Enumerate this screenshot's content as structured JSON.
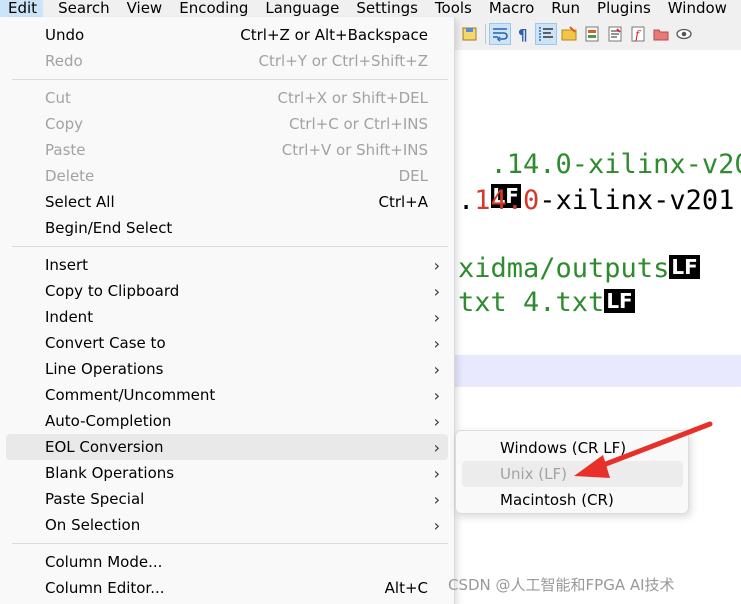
{
  "menubar": {
    "items": [
      "Edit",
      "Search",
      "View",
      "Encoding",
      "Language",
      "Settings",
      "Tools",
      "Macro",
      "Run",
      "Plugins",
      "Window"
    ]
  },
  "toolbar": {
    "icons": [
      "save-all-icon",
      "word-wrap-icon",
      "show-all-characters-icon",
      "indent-guide-icon",
      "folder-workspace-icon",
      "document-map-icon",
      "function-list-icon",
      "folder-icon",
      "monitoring-icon"
    ]
  },
  "editor": {
    "lines": [
      {
        "text": ".14.0-xilinx-v20",
        "color": "#2e8b2e"
      },
      {
        "eol": "LF"
      },
      {
        "text_red": "14.0",
        "text_dash": "-",
        "text_rest": "xilinx-v201",
        "prefix": "."
      },
      {
        "text": "xidma/outputs",
        "eol": "LF"
      },
      {
        "text": "txt 4.txt",
        "eol": "LF"
      }
    ]
  },
  "edit_menu": {
    "groups": [
      [
        {
          "label": "Undo",
          "shortcut": "Ctrl+Z or Alt+Backspace",
          "enabled": true
        },
        {
          "label": "Redo",
          "shortcut": "Ctrl+Y or Ctrl+Shift+Z",
          "enabled": false
        }
      ],
      [
        {
          "label": "Cut",
          "shortcut": "Ctrl+X or Shift+DEL",
          "enabled": false
        },
        {
          "label": "Copy",
          "shortcut": "Ctrl+C or Ctrl+INS",
          "enabled": false
        },
        {
          "label": "Paste",
          "shortcut": "Ctrl+V or Shift+INS",
          "enabled": false
        },
        {
          "label": "Delete",
          "shortcut": "DEL",
          "enabled": false
        },
        {
          "label": "Select All",
          "shortcut": "Ctrl+A",
          "enabled": true
        },
        {
          "label": "Begin/End Select",
          "shortcut": "",
          "enabled": true
        }
      ],
      [
        {
          "label": "Insert",
          "submenu": true
        },
        {
          "label": "Copy to Clipboard",
          "submenu": true
        },
        {
          "label": "Indent",
          "submenu": true
        },
        {
          "label": "Convert Case to",
          "submenu": true
        },
        {
          "label": "Line Operations",
          "submenu": true
        },
        {
          "label": "Comment/Uncomment",
          "submenu": true
        },
        {
          "label": "Auto-Completion",
          "submenu": true
        },
        {
          "label": "EOL Conversion",
          "submenu": true,
          "highlighted": true
        },
        {
          "label": "Blank Operations",
          "submenu": true
        },
        {
          "label": "Paste Special",
          "submenu": true
        },
        {
          "label": "On Selection",
          "submenu": true
        }
      ],
      [
        {
          "label": "Column Mode...",
          "shortcut": ""
        },
        {
          "label": "Column Editor...",
          "shortcut": "Alt+C"
        }
      ]
    ]
  },
  "eol_submenu": {
    "items": [
      {
        "label": "Windows (CR LF)",
        "enabled": true
      },
      {
        "label": "Unix (LF)",
        "enabled": false
      },
      {
        "label": "Macintosh (CR)",
        "enabled": true
      }
    ]
  },
  "annotation": {
    "color": "#e8302a"
  },
  "watermark": "CSDN @人工智能和FPGA AI技术"
}
